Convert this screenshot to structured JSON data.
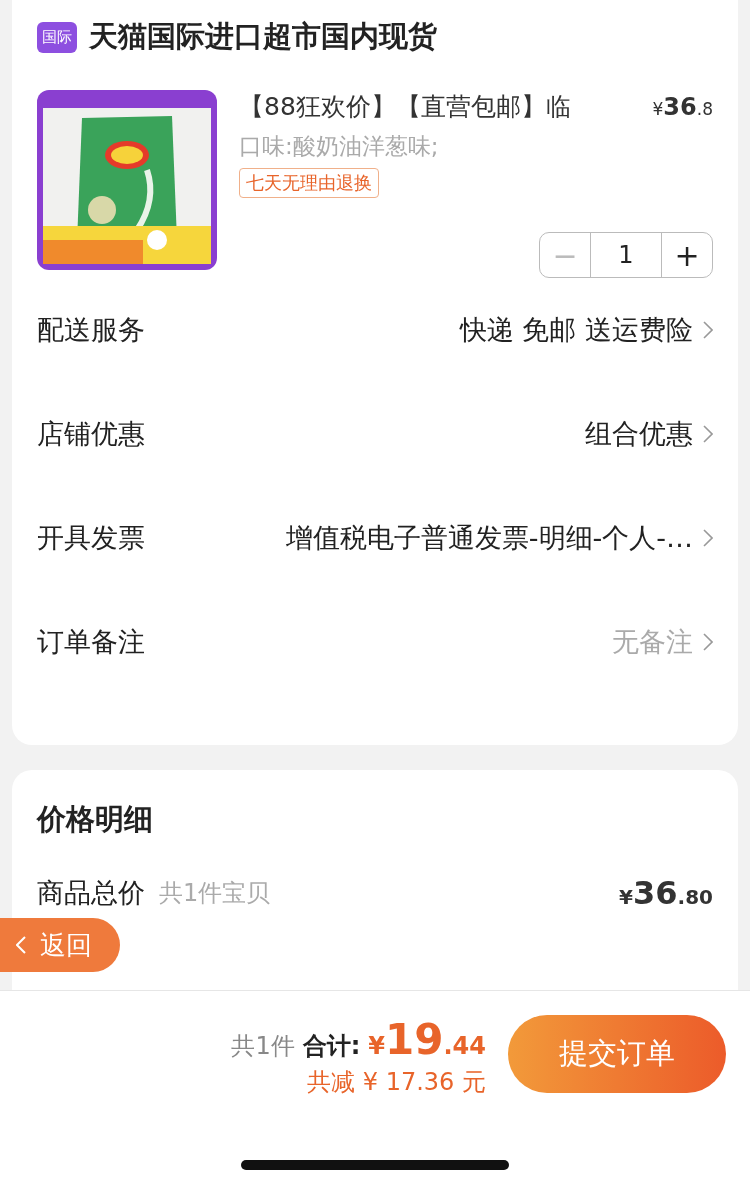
{
  "shop": {
    "badge": "国际",
    "name": "天猫国际进口超市国内现货"
  },
  "product": {
    "title": "【88狂欢价】【直营包邮】临",
    "price": {
      "currency": "¥",
      "integer": "36",
      "decimal": ".8"
    },
    "spec": "口味:酸奶油洋葱味;",
    "tag": "七天无理由退换",
    "quantity": {
      "minus": "−",
      "value": "1",
      "plus": "+",
      "minus_disabled": true
    }
  },
  "options": [
    {
      "label": "配送服务",
      "value": "快递 免邮 送运费险",
      "muted": false
    },
    {
      "label": "店铺优惠",
      "value": "组合优惠",
      "muted": false
    },
    {
      "label": "开具发票",
      "value": "增值税电子普通发票-明细-个人-…",
      "muted": false
    },
    {
      "label": "订单备注",
      "value": "无备注",
      "muted": true
    }
  ],
  "price_detail": {
    "title": "价格明细",
    "rows": [
      {
        "label": "商品总价",
        "note": "共1件宝贝",
        "currency": "¥",
        "integer": "36",
        "decimal": ".80"
      }
    ]
  },
  "back_button": {
    "label": "返回"
  },
  "footer": {
    "count": "共1件",
    "total_label": "合计:",
    "currency": "¥",
    "integer": "19",
    "decimal": ".44",
    "saving": "共减 ¥ 17.36 元",
    "submit": "提交订单"
  }
}
